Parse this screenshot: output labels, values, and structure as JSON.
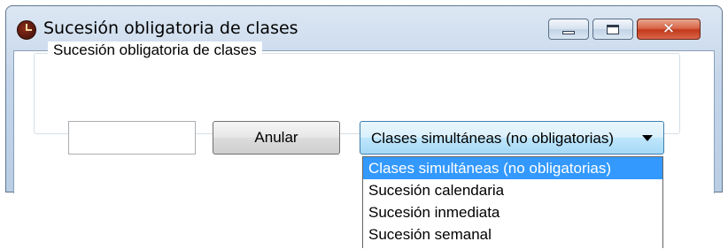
{
  "window": {
    "title": "Sucesión obligatoria de clases",
    "icon": "clock-icon",
    "accent_color": "#3399ff"
  },
  "groupbox": {
    "legend": "Sucesión obligatoria de clases"
  },
  "input": {
    "value": "",
    "placeholder": ""
  },
  "buttons": {
    "anular_label": "Anular",
    "close_glyph": "✕"
  },
  "select": {
    "selected_value": "Clases simultáneas (no obligatorias)",
    "options": [
      "Clases simultáneas (no obligatorias)",
      "Sucesión calendaria",
      "Sucesión inmediata",
      "Sucesión semanal"
    ]
  }
}
